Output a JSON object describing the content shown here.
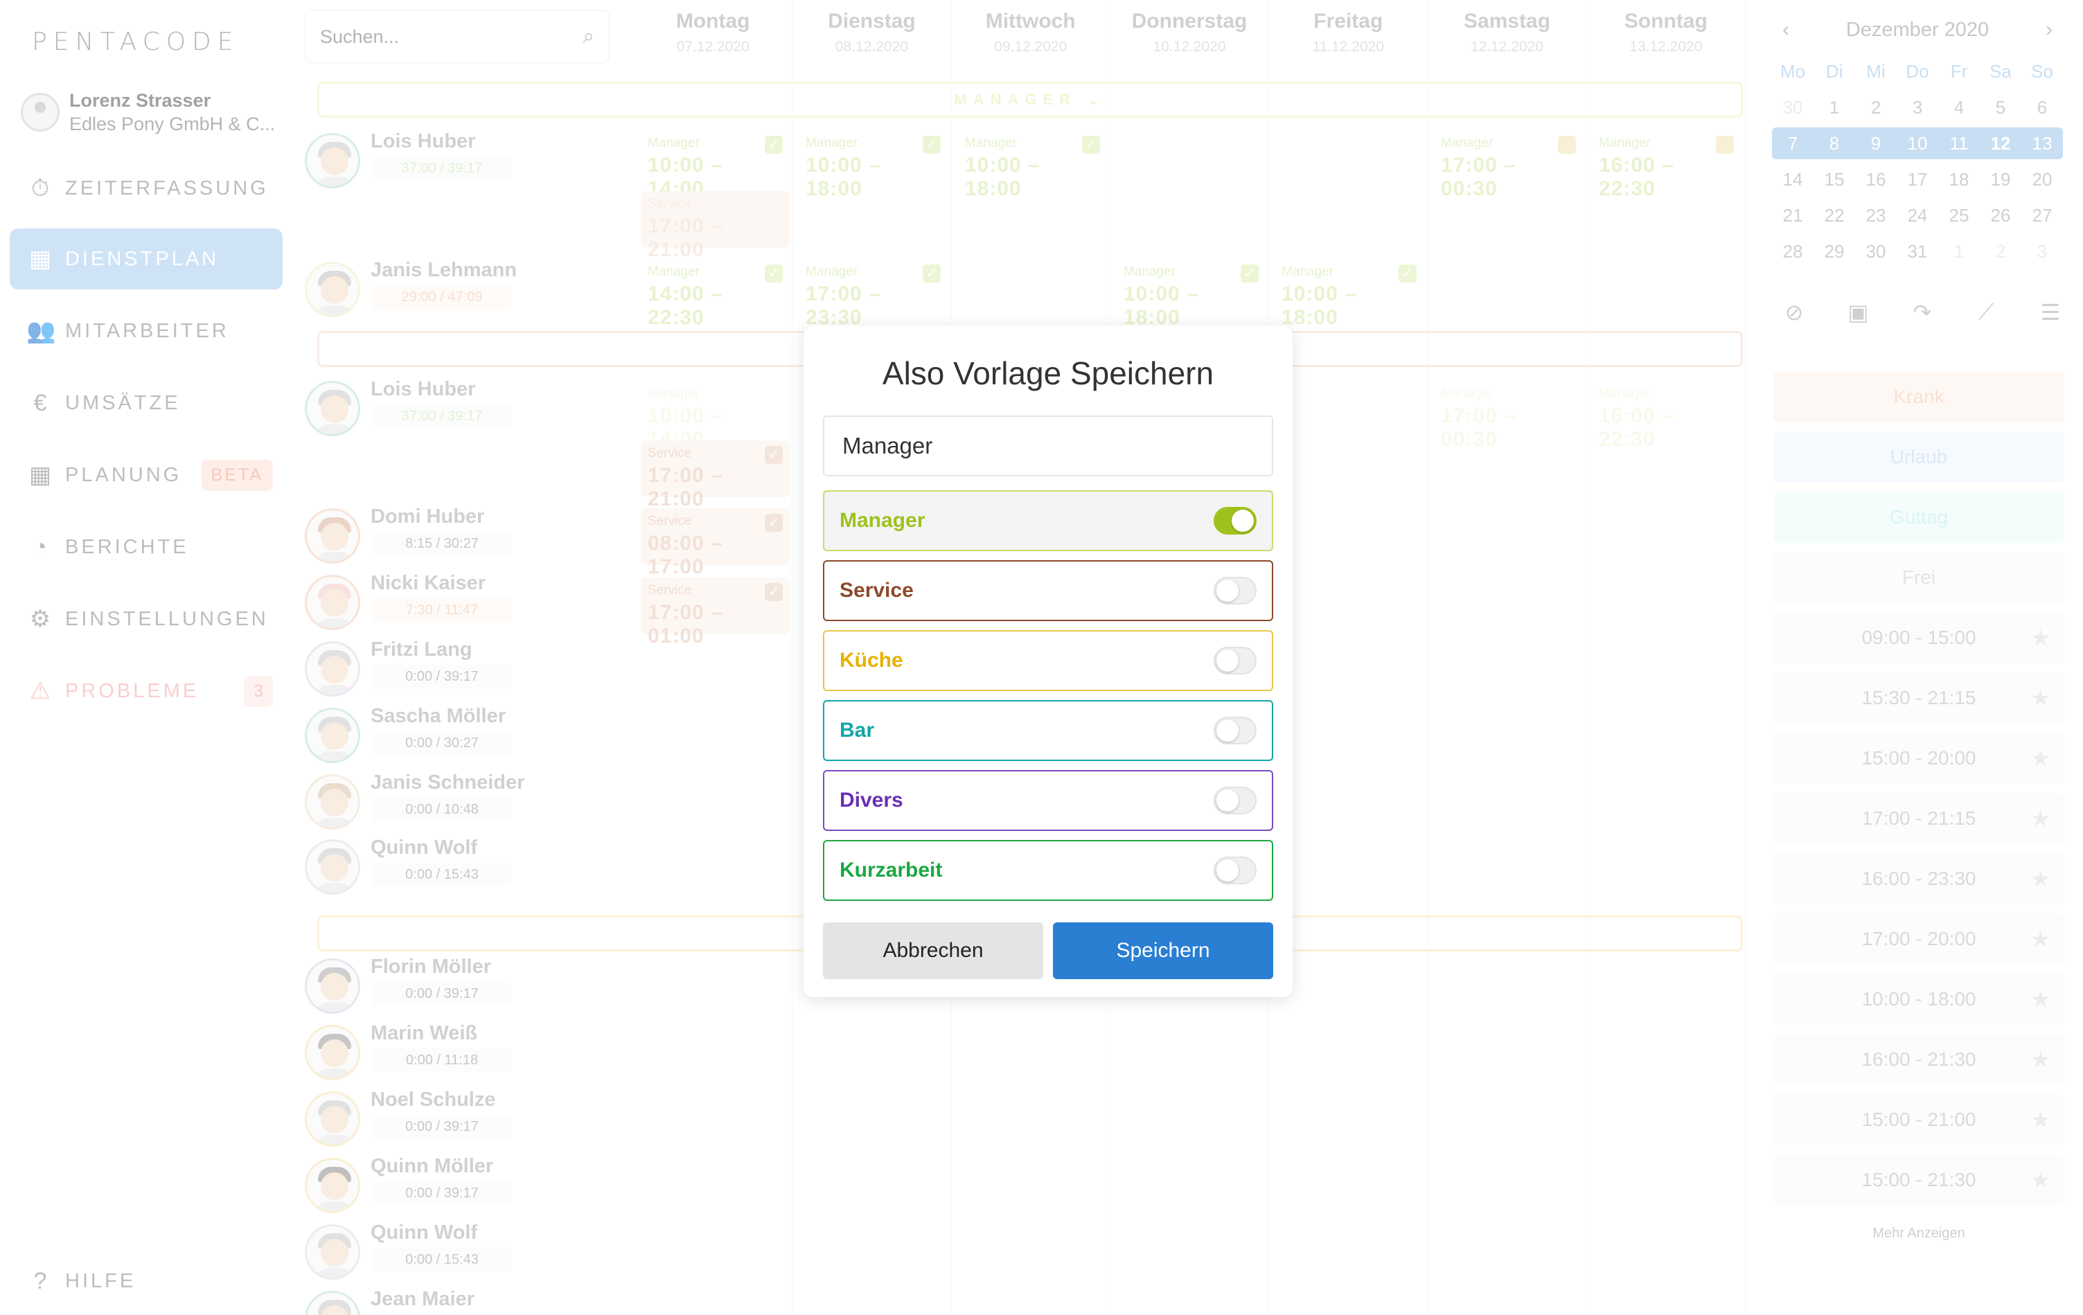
{
  "logo": "PENTACODE",
  "user": {
    "name": "Lorenz Strasser",
    "company": "Edles Pony GmbH & C..."
  },
  "nav": [
    {
      "icon": "stopwatch-icon",
      "label": "ZEITERFASSUNG"
    },
    {
      "icon": "table-icon",
      "label": "DIENSTPLAN"
    },
    {
      "icon": "users-icon",
      "label": "MITARBEITER"
    },
    {
      "icon": "euro-icon",
      "label": "UMSÄTZE"
    },
    {
      "icon": "calendar-icon",
      "label": "PLANUNG",
      "badge": "BETA"
    },
    {
      "icon": "pie-chart-icon",
      "label": "BERICHTE"
    },
    {
      "icon": "gear-icon",
      "label": "EINSTELLUNGEN"
    },
    {
      "icon": "warning-icon",
      "label": "PROBLEME",
      "badge": "3"
    }
  ],
  "help": "HILFE",
  "search": {
    "placeholder": "Suchen..."
  },
  "days": [
    {
      "name": "Montag",
      "date": "07.12.2020"
    },
    {
      "name": "Dienstag",
      "date": "08.12.2020"
    },
    {
      "name": "Mittwoch",
      "date": "09.12.2020"
    },
    {
      "name": "Donnerstag",
      "date": "10.12.2020"
    },
    {
      "name": "Freitag",
      "date": "11.12.2020"
    },
    {
      "name": "Samstag",
      "date": "12.12.2020"
    },
    {
      "name": "Sonntag",
      "date": "13.12.2020"
    }
  ],
  "group_manager": "MANAGER",
  "employees": [
    {
      "name": "Lois Huber",
      "hours": "37:00 / 39:17"
    },
    {
      "name": "Janis Lehmann",
      "hours": "29:00 / 47:09"
    },
    {
      "name": "Lois Huber",
      "hours": "37:00 / 39:17"
    },
    {
      "name": "Domi Huber",
      "hours": "8:15 / 30:27"
    },
    {
      "name": "Nicki Kaiser",
      "hours": "7:30 / 11:47"
    },
    {
      "name": "Fritzi Lang",
      "hours": "0:00 / 39:17"
    },
    {
      "name": "Sascha Möller",
      "hours": "0:00 / 30:27"
    },
    {
      "name": "Janis Schneider",
      "hours": "0:00 / 10:48"
    },
    {
      "name": "Quinn Wolf",
      "hours": "0:00 / 15:43"
    },
    {
      "name": "Florin Möller",
      "hours": "0:00 / 39:17"
    },
    {
      "name": "Marin Weiß",
      "hours": "0:00 / 11:18"
    },
    {
      "name": "Noel Schulze",
      "hours": "0:00 / 39:17"
    },
    {
      "name": "Quinn Möller",
      "hours": "0:00 / 39:17"
    },
    {
      "name": "Quinn Wolf",
      "hours": "0:00 / 15:43"
    },
    {
      "name": "Jean Maier",
      "hours": ""
    }
  ],
  "shifts": {
    "manager": "Manager",
    "service": "Service",
    "s1": "10:00 – 14:00",
    "s2": "10:00 – 18:00",
    "s3": "10:00 – 18:00",
    "s4": "17:00 – 00:30",
    "s5": "16:00 – 22:30",
    "s6": "17:00 – 21:00",
    "s7": "14:00 – 22:30",
    "s8": "17:00 – 23:30",
    "s9": "10:00 – 18:00",
    "s10": "10:00 – 18:00",
    "s11": "10:00 – 14:00",
    "s12": "17:00 – 21:00",
    "s13": "17:00 – 00:30",
    "s14": "16:00 – 22:30",
    "s15": "08:00 – 17:00",
    "s16": "17:00 – 01:00"
  },
  "calendar": {
    "month": "Dezember 2020",
    "weekdays": [
      "Mo",
      "Di",
      "Mi",
      "Do",
      "Fr",
      "Sa",
      "So"
    ],
    "rows": [
      [
        "30",
        "1",
        "2",
        "3",
        "4",
        "5",
        "6"
      ],
      [
        "7",
        "8",
        "9",
        "10",
        "11",
        "12",
        "13"
      ],
      [
        "14",
        "15",
        "16",
        "17",
        "18",
        "19",
        "20"
      ],
      [
        "21",
        "22",
        "23",
        "24",
        "25",
        "26",
        "27"
      ],
      [
        "28",
        "29",
        "30",
        "31",
        "1",
        "2",
        "3"
      ]
    ]
  },
  "templates": {
    "krank": "Krank",
    "urlaub": "Urlaub",
    "guttag": "Guttag",
    "frei": "Frei",
    "times": [
      "09:00 - 15:00",
      "15:30 - 21:15",
      "15:00 - 20:00",
      "17:00 - 21:15",
      "16:00 - 23:30",
      "17:00 - 20:00",
      "10:00 - 18:00",
      "16:00 - 21:30",
      "15:00 - 21:00",
      "15:00 - 21:30"
    ],
    "more": "Mehr Anzeigen"
  },
  "modal": {
    "title": "Also Vorlage Speichern",
    "name_value": "Manager",
    "categories": [
      {
        "label": "Manager",
        "color": "#9ec21d",
        "on": true
      },
      {
        "label": "Service",
        "color": "#8b4a2b",
        "on": false
      },
      {
        "label": "Küche",
        "color": "#e8b100",
        "on": false
      },
      {
        "label": "Bar",
        "color": "#12a6a6",
        "on": false
      },
      {
        "label": "Divers",
        "color": "#6a2fb5",
        "on": false
      },
      {
        "label": "Kurzarbeit",
        "color": "#1aa842",
        "on": false
      }
    ],
    "cancel": "Abbrechen",
    "save": "Speichern"
  }
}
